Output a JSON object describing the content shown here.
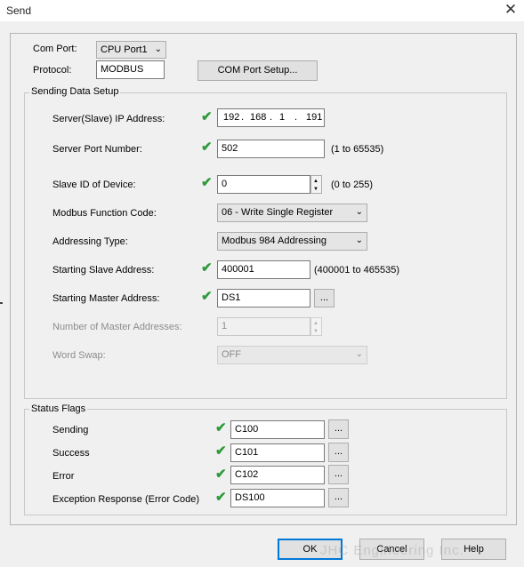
{
  "window": {
    "title": "Send",
    "close_glyph": "✕"
  },
  "com_port": {
    "label": "Com Port:",
    "value": "CPU Port1"
  },
  "protocol": {
    "label": "Protocol:",
    "value": "MODBUS"
  },
  "com_port_setup_button": "COM Port Setup...",
  "sending_data_setup": {
    "title": "Sending Data Setup",
    "server_ip": {
      "label": "Server(Slave) IP Address:",
      "octets": [
        "192",
        "168",
        "1",
        "191"
      ],
      "separator": "."
    },
    "server_port": {
      "label": "Server Port Number:",
      "value": "502",
      "range": "(1 to 65535)"
    },
    "slave_id": {
      "label": "Slave ID of Device:",
      "value": "0",
      "range": "(0 to 255)"
    },
    "function_code": {
      "label": "Modbus Function Code:",
      "value": "06 - Write Single Register"
    },
    "addressing_type": {
      "label": "Addressing Type:",
      "value": "Modbus 984 Addressing"
    },
    "starting_slave": {
      "label": "Starting Slave Address:",
      "value": "400001",
      "range": "(400001 to 465535)"
    },
    "starting_master": {
      "label": "Starting Master Address:",
      "value": "DS1",
      "browse": "..."
    },
    "num_master": {
      "label": "Number of Master Addresses:",
      "value": "1"
    },
    "word_swap": {
      "label": "Word Swap:",
      "value": "OFF"
    }
  },
  "status_flags": {
    "title": "Status Flags",
    "items": [
      {
        "label": "Sending",
        "value": "C100",
        "browse": "..."
      },
      {
        "label": "Success",
        "value": "C101",
        "browse": "..."
      },
      {
        "label": "Error",
        "value": "C102",
        "browse": "..."
      },
      {
        "label": "Exception Response (Error Code)",
        "value": "DS100",
        "browse": "..."
      }
    ]
  },
  "buttons": {
    "ok": "OK",
    "cancel": "Cancel",
    "help": "Help"
  },
  "watermark": "JHC Engineering Inc.",
  "colors": {
    "check": "#2e9a3a",
    "default_button_border": "#0078d7"
  }
}
